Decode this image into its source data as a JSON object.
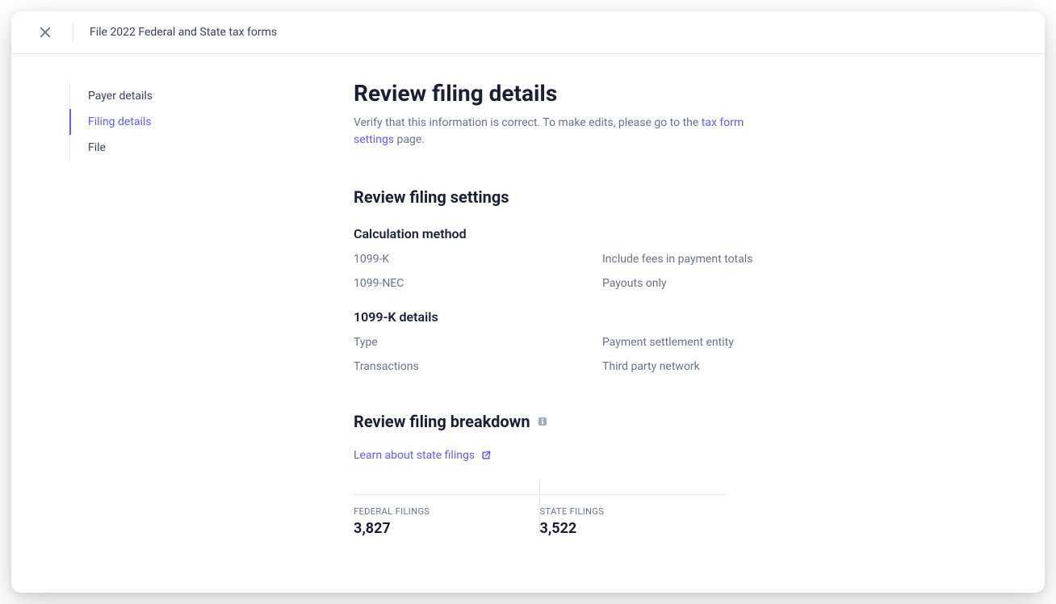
{
  "header": {
    "title": "File 2022 Federal and State tax forms"
  },
  "sidebar": {
    "items": [
      {
        "label": "Payer details",
        "active": false
      },
      {
        "label": "Filing details",
        "active": true
      },
      {
        "label": "File",
        "active": false
      }
    ]
  },
  "main": {
    "title": "Review filing details",
    "subtitle_before": "Verify that this information is correct. To make edits, please go to the ",
    "subtitle_link": "tax form settings",
    "subtitle_after": " page.",
    "settings": {
      "heading": "Review filing settings",
      "calc": {
        "heading": "Calculation method",
        "rows": [
          {
            "key": "1099-K",
            "val": "Include fees in payment totals"
          },
          {
            "key": "1099-NEC",
            "val": "Payouts only"
          }
        ]
      },
      "kdetails": {
        "heading": "1099-K details",
        "rows": [
          {
            "key": "Type",
            "val": "Payment settlement entity"
          },
          {
            "key": "Transactions",
            "val": "Third party network"
          }
        ]
      }
    },
    "breakdown": {
      "heading": "Review filing breakdown",
      "learn_link": "Learn about state filings",
      "federal_label": "FEDERAL FILINGS",
      "federal_value": "3,827",
      "state_label": "STATE FILINGS",
      "state_value": "3,522"
    }
  }
}
